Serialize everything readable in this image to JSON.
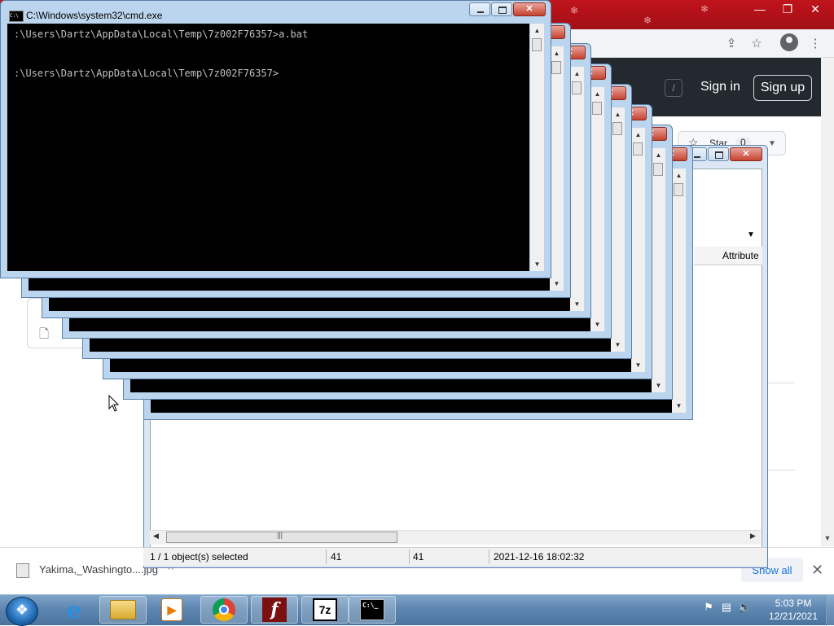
{
  "cmd": {
    "title": "C:\\Windows\\system32\\cmd.exe",
    "lines": [
      ":\\Users\\Dartz\\AppData\\Local\\Temp\\7z002F76357>a.bat",
      ":\\Users\\Dartz\\AppData\\Local\\Temp\\7z002F76357>"
    ]
  },
  "browser": {
    "sign_in": "Sign in",
    "sign_up": "Sign up",
    "search_key": "/",
    "star_label": "Star",
    "star_count": "0"
  },
  "download": {
    "file_name": "Yakima,_Washingto....jpg",
    "show_all": "Show all"
  },
  "sevenzip": {
    "column_attributes": "Attribute",
    "status_selected": "1 / 1 object(s) selected",
    "status_size": "41",
    "status_packed": "41",
    "status_modified": "2021-12-16 18:02:32"
  },
  "taskbar": {
    "time": "5:03 PM",
    "date": "12/21/2021"
  },
  "icons": [
    "windows-orb-icon",
    "ie-icon",
    "explorer-folder-icon",
    "media-player-icon",
    "chrome-icon",
    "flash-icon",
    "7zip-icon",
    "cmd-icon"
  ]
}
